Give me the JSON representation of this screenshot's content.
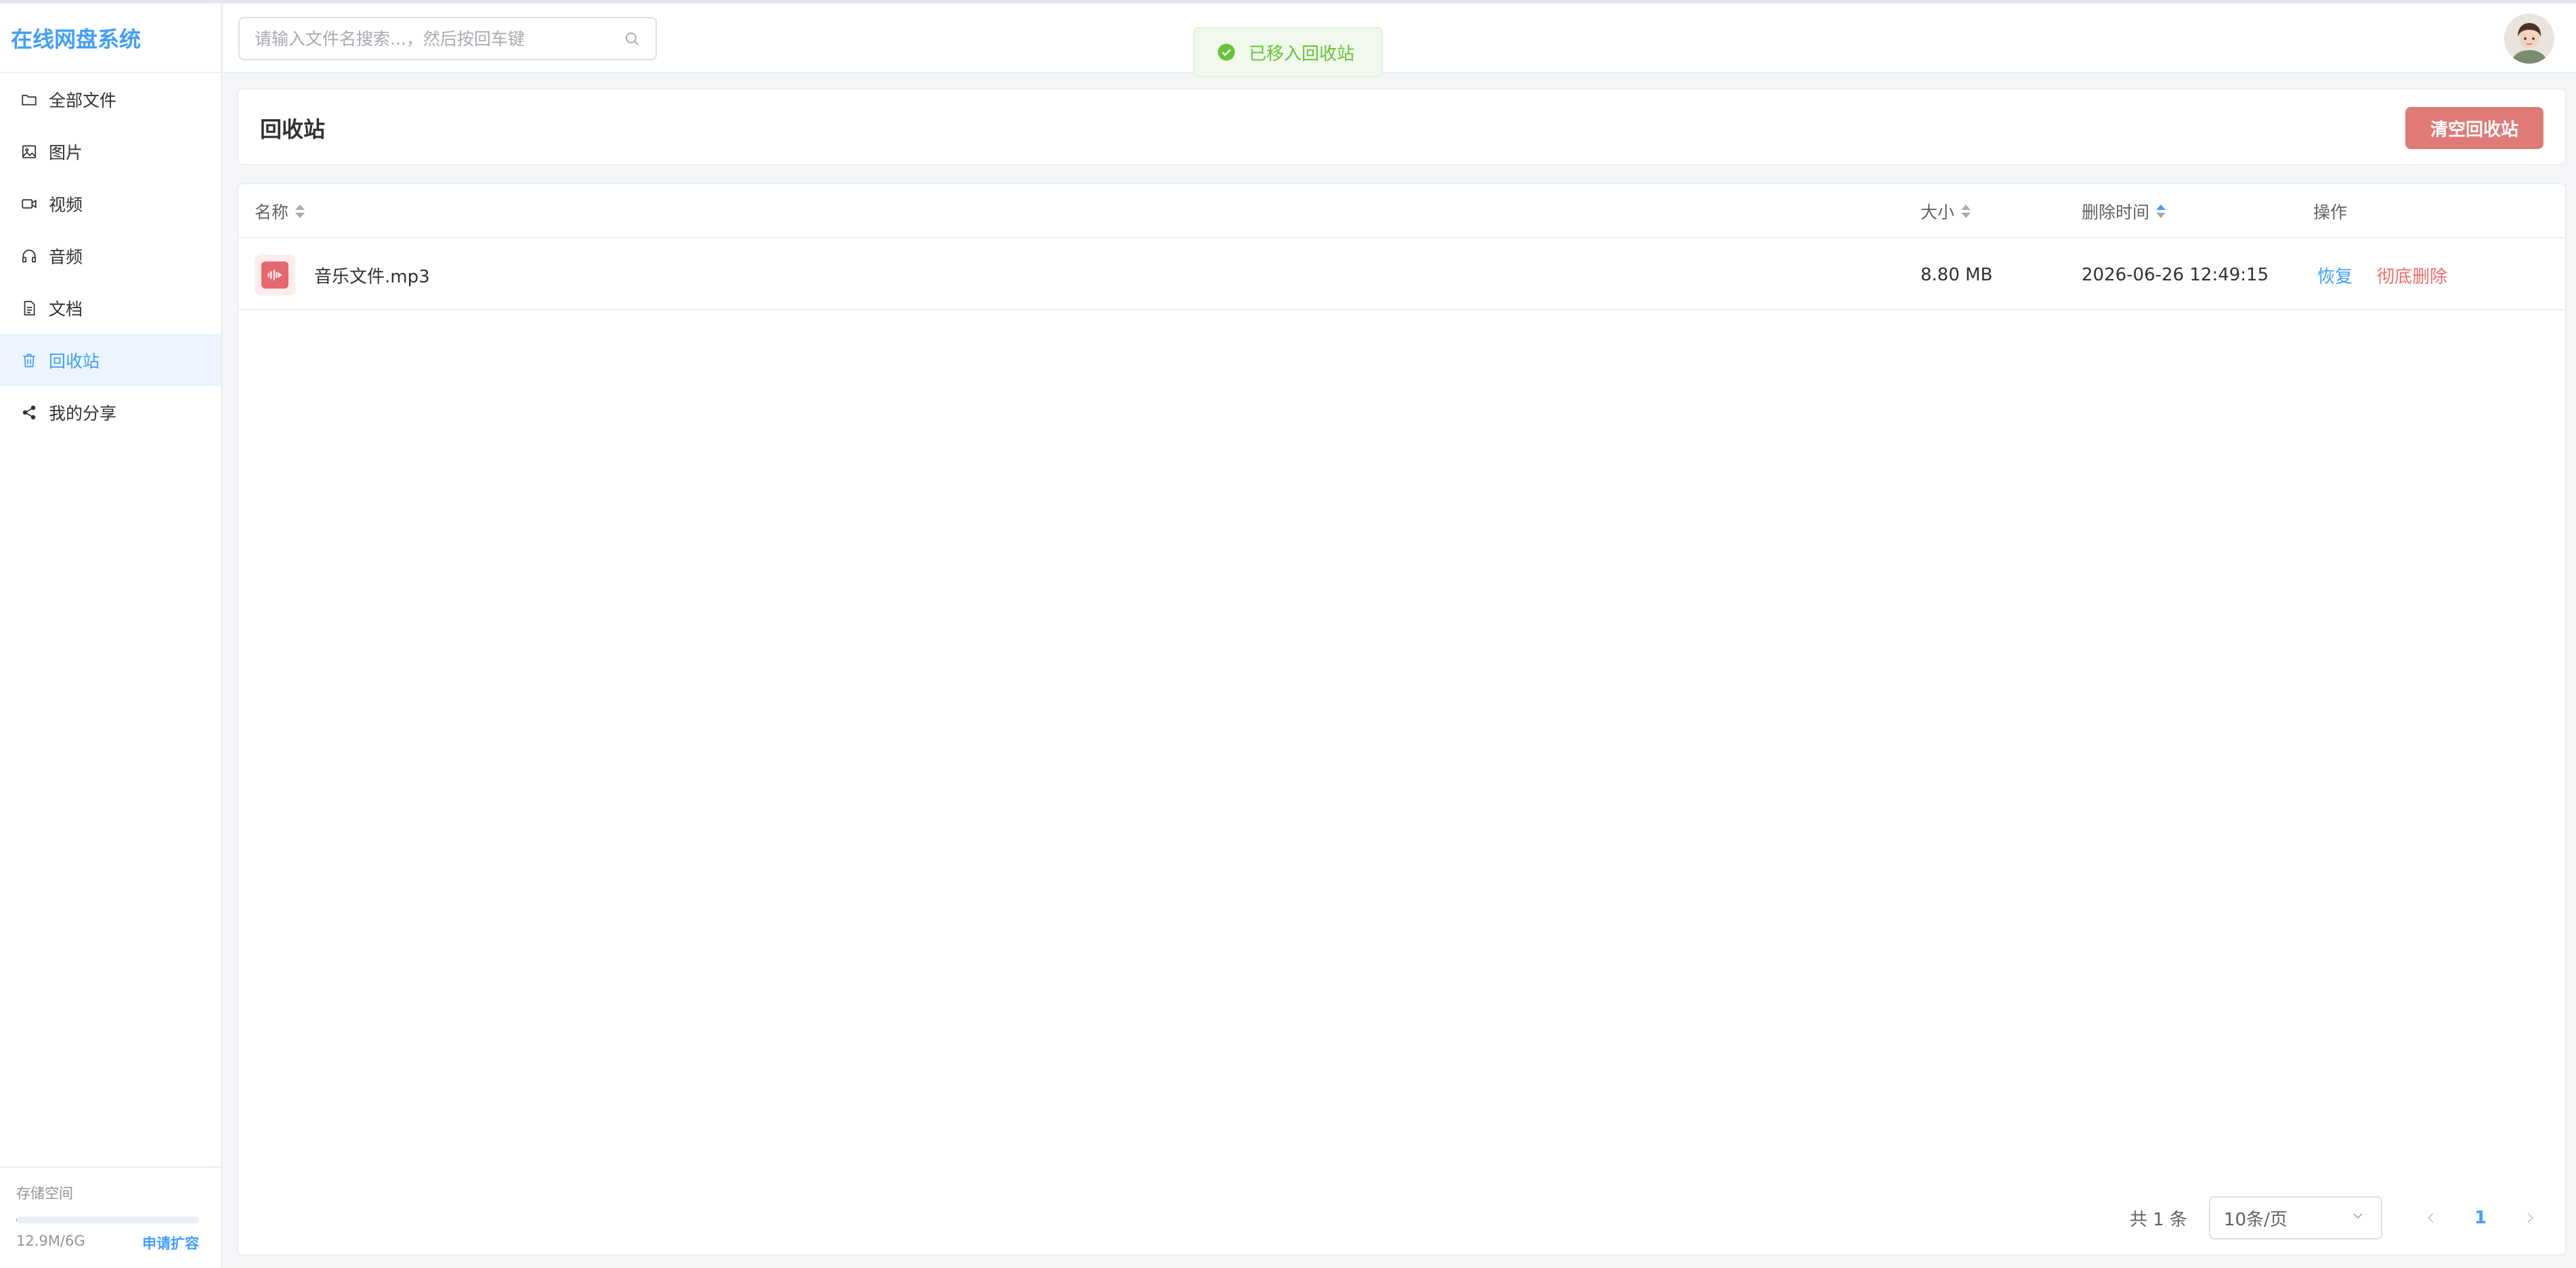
{
  "app": {
    "title": "在线网盘系统"
  },
  "sidebar": {
    "items": [
      {
        "label": "全部文件",
        "icon": "folder-icon"
      },
      {
        "label": "图片",
        "icon": "image-icon"
      },
      {
        "label": "视频",
        "icon": "video-icon"
      },
      {
        "label": "音频",
        "icon": "headphones-icon"
      },
      {
        "label": "文档",
        "icon": "document-icon"
      },
      {
        "label": "回收站",
        "icon": "trash-icon",
        "active": true
      },
      {
        "label": "我的分享",
        "icon": "share-icon"
      }
    ],
    "storage": {
      "label": "存储空间",
      "used": "12.9M/6G",
      "used_fraction": 0.002,
      "expand_label": "申请扩容"
    }
  },
  "header": {
    "search": {
      "placeholder": "请输入文件名搜索...，然后按回车键",
      "value": ""
    }
  },
  "toast": {
    "text": "已移入回收站",
    "type": "success"
  },
  "page": {
    "title": "回收站",
    "empty_button": "清空回收站"
  },
  "table": {
    "columns": {
      "name": "名称",
      "size": "大小",
      "deleted_at": "删除时间",
      "actions": "操作"
    },
    "rows": [
      {
        "name": "音乐文件.mp3",
        "icon": "audio-file-icon",
        "size": "8.80 MB",
        "deleted_at": "2026-06-26 12:49:15",
        "restore": "恢复",
        "delete": "彻底删除"
      }
    ]
  },
  "pagination": {
    "total": "共 1 条",
    "page_size": "10条/页",
    "current": "1"
  },
  "colors": {
    "accent": "#409eff",
    "danger_button": "#e07a77",
    "danger_text": "#f56c6c",
    "success": "#67c23a",
    "file_icon": "#e8666f"
  }
}
